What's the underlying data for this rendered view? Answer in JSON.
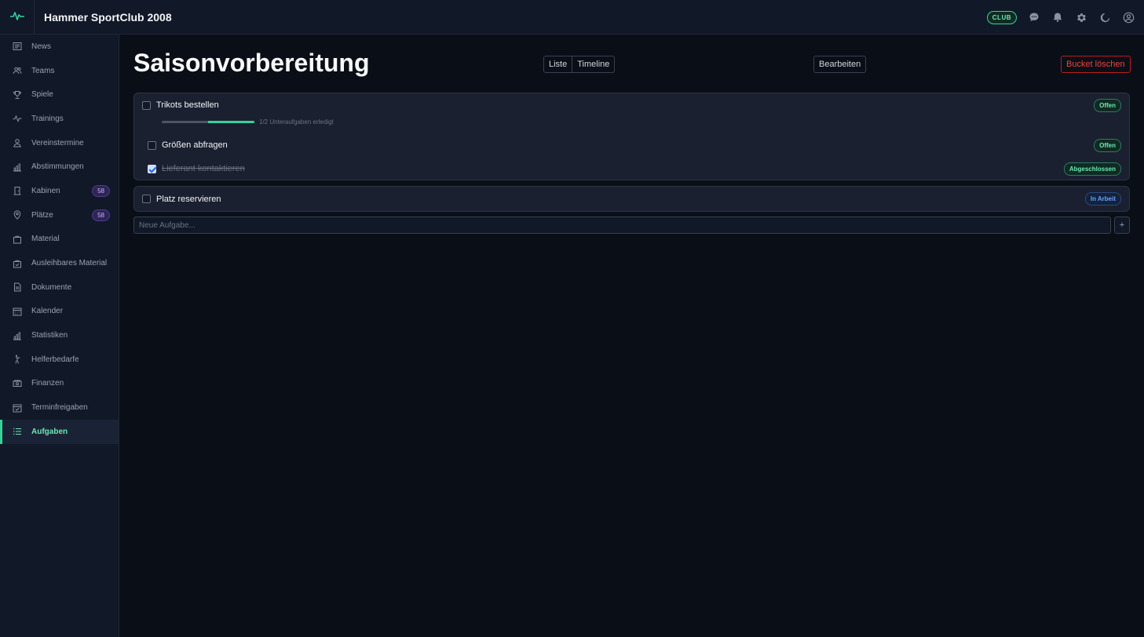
{
  "app": {
    "title": "Hammer SportClub 2008",
    "badge": "CLUB"
  },
  "header_icons": [
    "chat-icon",
    "bell-icon",
    "gear-icon",
    "moon-icon",
    "user-icon"
  ],
  "sidebar": {
    "items": [
      {
        "label": "News",
        "icon": "newspaper-icon"
      },
      {
        "label": "Teams",
        "icon": "users-icon"
      },
      {
        "label": "Spiele",
        "icon": "trophy-icon"
      },
      {
        "label": "Trainings",
        "icon": "activity-icon"
      },
      {
        "label": "Vereinstermine",
        "icon": "person-icon"
      },
      {
        "label": "Abstimmungen",
        "icon": "bar-chart-icon"
      },
      {
        "label": "Kabinen",
        "icon": "door-icon",
        "count": "58"
      },
      {
        "label": "Plätze",
        "icon": "map-pin-icon",
        "count": "58"
      },
      {
        "label": "Material",
        "icon": "bag-icon"
      },
      {
        "label": "Ausleihbares Material",
        "icon": "bag-check-icon"
      },
      {
        "label": "Dokumente",
        "icon": "document-icon"
      },
      {
        "label": "Kalender",
        "icon": "calendar-icon"
      },
      {
        "label": "Statistiken",
        "icon": "bar-chart-icon"
      },
      {
        "label": "Helferbedarfe",
        "icon": "helper-icon"
      },
      {
        "label": "Finanzen",
        "icon": "money-icon"
      },
      {
        "label": "Terminfreigaben",
        "icon": "calendar-check-icon"
      },
      {
        "label": "Aufgaben",
        "icon": "list-icon",
        "active": true
      }
    ]
  },
  "main": {
    "title": "Saisonvorbereitung",
    "view_toggle": [
      "Liste",
      "Timeline"
    ],
    "edit_label": "Bearbeiten",
    "delete_label": "Bucket löschen",
    "tasks": [
      {
        "name": "Trikots bestellen",
        "status": "Offen",
        "progress": {
          "done": 1,
          "total": 2,
          "fraction": 0.5,
          "text": "1/2 Unteraufgaben erledigt"
        },
        "subtasks": [
          {
            "name": "Größen abfragen",
            "status": "Offen",
            "done": false
          },
          {
            "name": "Lieferant kontaktieren",
            "status": "Abgeschlossen",
            "done": true
          }
        ]
      },
      {
        "name": "Platz reservieren",
        "status": "In Arbeit"
      }
    ],
    "new_task_placeholder": "Neue Aufgabe...",
    "add_label": "+"
  },
  "colors": {
    "accent": "#34d399",
    "danger": "#ef4444",
    "info": "#60a5fa",
    "badge": "#c4b5fd"
  }
}
